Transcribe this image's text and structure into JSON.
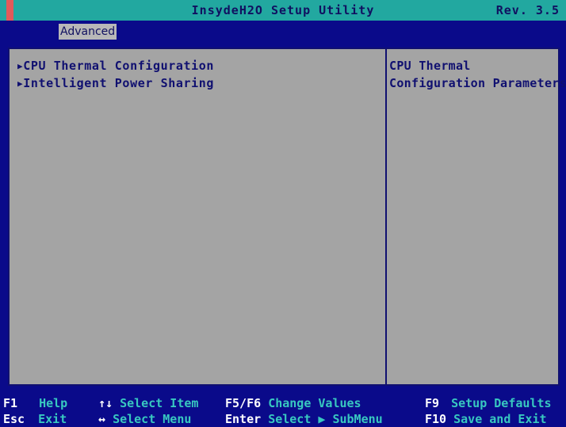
{
  "title_bar": {
    "title": "InsydeH2O Setup Utility",
    "revision": "Rev. 3.5"
  },
  "menu": {
    "active_tab": "Advanced"
  },
  "items": [
    {
      "arrow": "▶",
      "label": "CPU Thermal Configuration"
    },
    {
      "arrow": "▶",
      "label": "Intelligent Power Sharing"
    }
  ],
  "help": {
    "line1": "CPU Thermal",
    "line2": "Configuration Parameters"
  },
  "footer": {
    "help_key": "F1",
    "help_desc": "Help",
    "exit_key": "Esc",
    "exit_desc": "Exit",
    "select_item_key": "↑↓",
    "select_item_desc": "Select Item",
    "select_menu_key": "↔",
    "select_menu_desc": "Select Menu",
    "change_key": "F5/F6",
    "change_desc": "Change Values",
    "enter_key": "Enter",
    "enter_desc": "Select ▶ SubMenu",
    "defaults_key": "F9",
    "defaults_desc": "Setup Defaults",
    "save_key": "F10",
    "save_desc": "Save and Exit"
  },
  "colors": {
    "title_bar": "#22a8a0",
    "background": "#0a0a8a",
    "panel": "#a4a4a4",
    "text": "#101070",
    "footer_text": "#38c8c0"
  }
}
